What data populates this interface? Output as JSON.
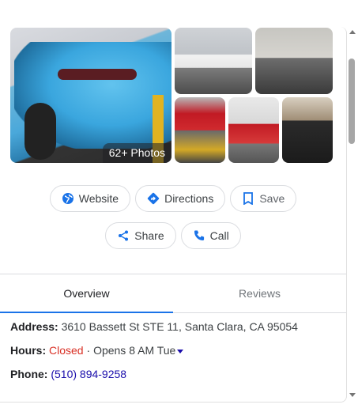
{
  "photos": {
    "count_label": "62+ Photos"
  },
  "actions": {
    "website": "Website",
    "directions": "Directions",
    "save": "Save",
    "share": "Share",
    "call": "Call"
  },
  "tabs": {
    "overview": "Overview",
    "reviews": "Reviews"
  },
  "info": {
    "address_label": "Address:",
    "address_value": "3610 Bassett St STE 11, Santa Clara, CA 95054",
    "hours_label": "Hours:",
    "hours_status": "Closed",
    "hours_sep": " · ",
    "hours_next": "Opens 8 AM Tue",
    "phone_label": "Phone:",
    "phone_value": "(510) 894-9258"
  },
  "colors": {
    "accent": "#1a73e8",
    "closed": "#d93025",
    "link": "#1a0dab"
  },
  "icons": [
    "globe-icon",
    "directions-icon",
    "bookmark-icon",
    "share-icon",
    "phone-icon",
    "caret-down-icon"
  ]
}
